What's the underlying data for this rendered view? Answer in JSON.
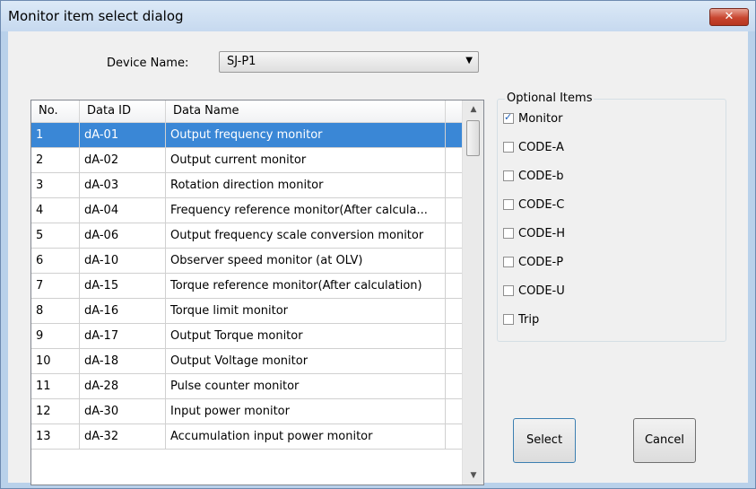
{
  "window": {
    "title": "Monitor item select dialog",
    "close_glyph": "✕"
  },
  "device": {
    "label": "Device Name:",
    "value": "SJ-P1",
    "arrow": "▼"
  },
  "table": {
    "headers": {
      "no": "No.",
      "id": "Data ID",
      "name": "Data Name"
    },
    "rows": [
      {
        "no": "1",
        "id": "dA-01",
        "name": "Output frequency monitor",
        "selected": true
      },
      {
        "no": "2",
        "id": "dA-02",
        "name": "Output current monitor"
      },
      {
        "no": "3",
        "id": "dA-03",
        "name": "Rotation direction monitor"
      },
      {
        "no": "4",
        "id": "dA-04",
        "name": "Frequency reference monitor(After calcula..."
      },
      {
        "no": "5",
        "id": "dA-06",
        "name": "Output frequency scale conversion monitor"
      },
      {
        "no": "6",
        "id": "dA-10",
        "name": "Observer speed monitor (at OLV)"
      },
      {
        "no": "7",
        "id": "dA-15",
        "name": "Torque reference monitor(After calculation)"
      },
      {
        "no": "8",
        "id": "dA-16",
        "name": "Torque limit monitor"
      },
      {
        "no": "9",
        "id": "dA-17",
        "name": "Output Torque monitor"
      },
      {
        "no": "10",
        "id": "dA-18",
        "name": "Output Voltage monitor"
      },
      {
        "no": "11",
        "id": "dA-28",
        "name": "Pulse counter monitor"
      },
      {
        "no": "12",
        "id": "dA-30",
        "name": "Input power monitor"
      },
      {
        "no": "13",
        "id": "dA-32",
        "name": "Accumulation input power monitor"
      }
    ],
    "scroll_up": "▲",
    "scroll_down": "▼"
  },
  "optional": {
    "legend": "Optional Items",
    "items": [
      {
        "label": "Monitor",
        "checked": true
      },
      {
        "label": "CODE-A",
        "checked": false
      },
      {
        "label": "CODE-b",
        "checked": false
      },
      {
        "label": "CODE-C",
        "checked": false
      },
      {
        "label": "CODE-H",
        "checked": false
      },
      {
        "label": "CODE-P",
        "checked": false
      },
      {
        "label": "CODE-U",
        "checked": false
      },
      {
        "label": "Trip",
        "checked": false
      }
    ]
  },
  "buttons": {
    "select": "Select",
    "cancel": "Cancel"
  },
  "colors": {
    "selection": "#3a87d6",
    "titlebar": "#c6d9ef",
    "close": "#c8452f"
  }
}
